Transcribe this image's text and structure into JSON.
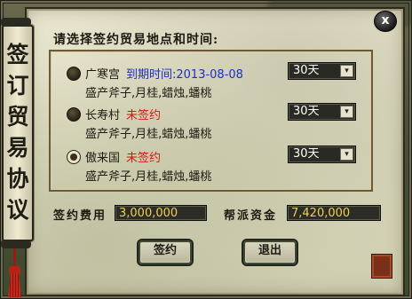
{
  "banner": {
    "title": "签订贸易协议"
  },
  "prompt": "请选择签约贸易地点和时间:",
  "regions": [
    {
      "name": "广寒宫",
      "status": "到期时间:2013-08-08",
      "status_color": "#1d2fbf",
      "products": "盛产斧子,月桂,蜡烛,蟠桃",
      "duration": "30天",
      "selected": false
    },
    {
      "name": "长寿村",
      "status": "未签约",
      "status_color": "#cc1c12",
      "products": "盛产斧子,月桂,蜡烛,蟠桃",
      "duration": "30天",
      "selected": false
    },
    {
      "name": "傲来国",
      "status": "未签约",
      "status_color": "#cc1c12",
      "products": "盛产斧子,月桂,蜡烛,蟠桃",
      "duration": "30天",
      "selected": true
    }
  ],
  "fee": {
    "label": "签约费用",
    "value": "3,000,000"
  },
  "funds": {
    "label": "帮派资金",
    "value": "7,420,000"
  },
  "buttons": {
    "sign": "签约",
    "exit": "退出",
    "close": "x"
  },
  "colors": {
    "value_text": "#f1cf54",
    "panel": "#d9d8bc"
  }
}
